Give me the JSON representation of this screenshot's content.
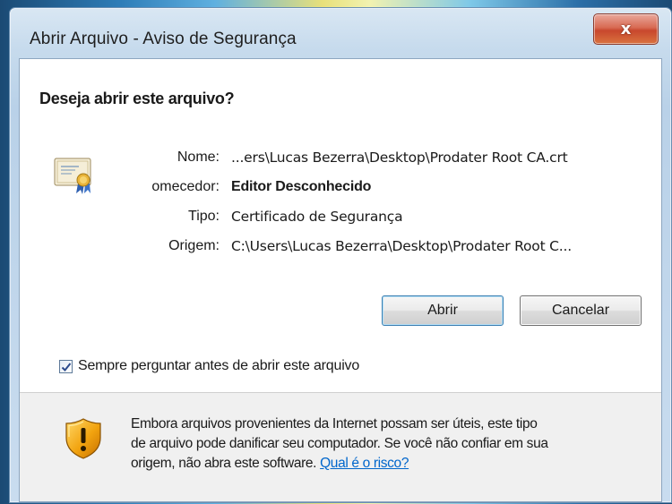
{
  "window": {
    "title": "Abrir Arquivo - Aviso de Segurança",
    "close_glyph": "x"
  },
  "dialog": {
    "heading": "Deseja abrir este arquivo?",
    "fields": [
      {
        "label": "Nome:",
        "value": "...ers\\Lucas Bezerra\\Desktop\\Prodater Root CA.crt"
      },
      {
        "label": "omecedor:",
        "value": "Editor Desconhecido"
      },
      {
        "label": "Tipo:",
        "value": "Certificado de Segurança"
      },
      {
        "label": "Origem:",
        "value": "C:\\Users\\Lucas Bezerra\\Desktop\\Prodater Root C..."
      }
    ],
    "buttons": {
      "open": "Abrir",
      "cancel": "Cancelar"
    },
    "checkbox": {
      "label": "Sempre perguntar antes de abrir este arquivo",
      "checked": true
    }
  },
  "footer": {
    "line1": "Embora arquivos provenientes da Internet possam ser úteis, este tipo",
    "line2": "de arquivo pode danificar seu computador. Se você não confiar em sua",
    "line3_prefix": "origem, não abra este software. ",
    "risk_link": "Qual é o risco?"
  },
  "colors": {
    "link": "#0066cc",
    "close_button": "#c8472d",
    "shield": "#f2a30f"
  },
  "icons": {
    "certificate": "certificate-icon",
    "shield": "warning-shield-icon",
    "check": "check-icon"
  }
}
